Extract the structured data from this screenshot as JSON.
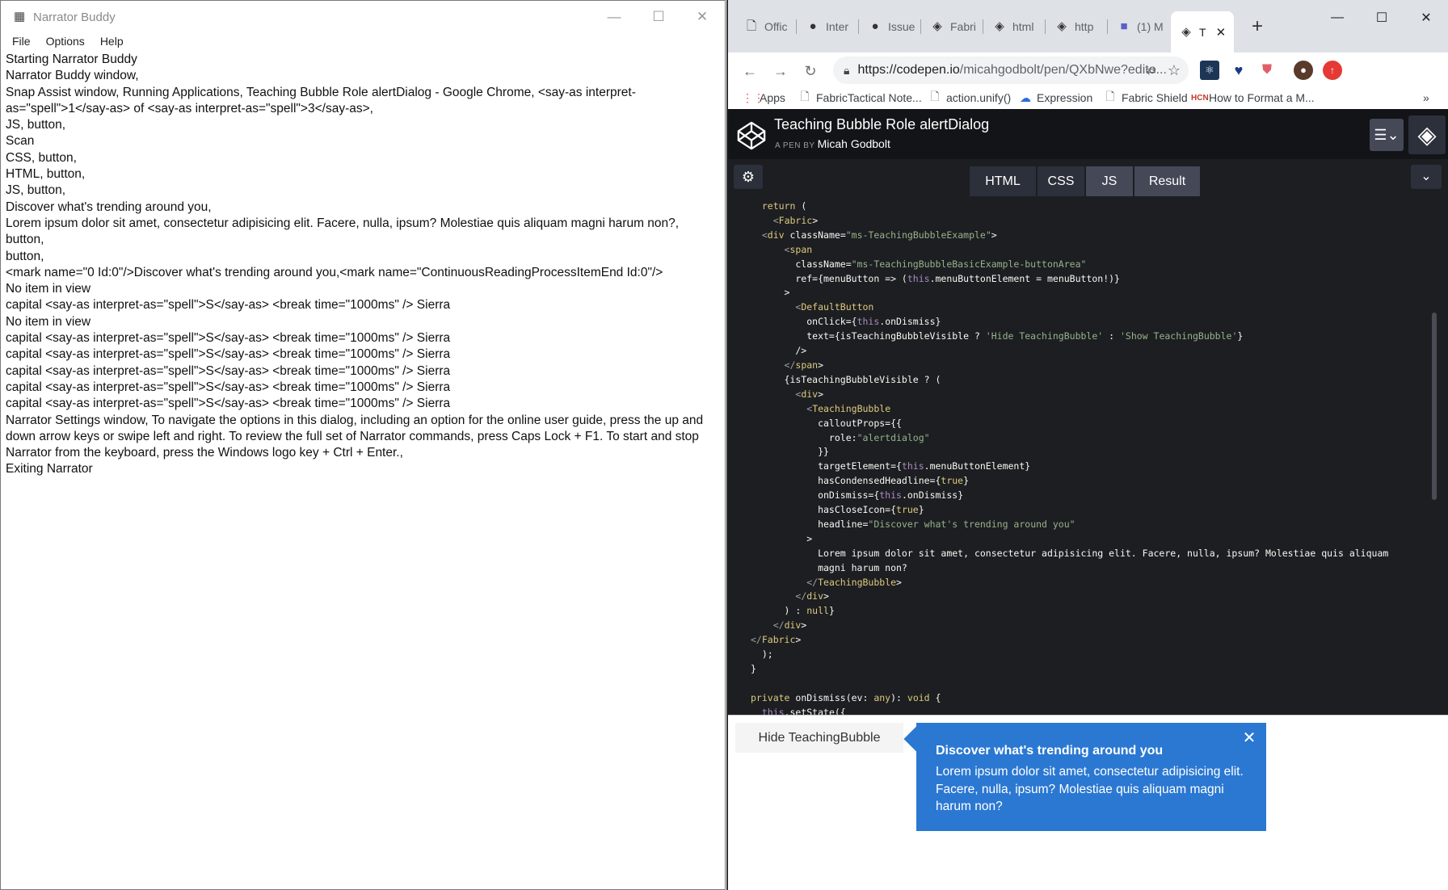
{
  "narrator": {
    "title": "Narrator Buddy",
    "menu": [
      "File",
      "Options",
      "Help"
    ],
    "log": [
      "Starting Narrator Buddy",
      "Narrator Buddy window,",
      "Snap Assist window, Running Applications, Teaching Bubble Role alertDialog - Google Chrome, <say-as interpret-as=\"spell\">1</say-as> of <say-as interpret-as=\"spell\">3</say-as>,",
      "JS, button,",
      "Scan",
      "CSS, button,",
      "HTML, button,",
      "JS, button,",
      "Discover what's trending around you,",
      "Lorem ipsum dolor sit amet, consectetur adipisicing elit. Facere, nulla, ipsum? Molestiae quis aliquam magni harum non?, button,",
      "button,",
      "<mark name=\"0 Id:0\"/>Discover what's trending around you,<mark name=\"ContinuousReadingProcessItemEnd Id:0\"/>",
      "No item in view",
      "capital <say-as interpret-as=\"spell\">S</say-as> <break time=\"1000ms\" /> Sierra",
      "No item in view",
      "capital <say-as interpret-as=\"spell\">S</say-as> <break time=\"1000ms\" /> Sierra",
      "capital <say-as interpret-as=\"spell\">S</say-as> <break time=\"1000ms\" /> Sierra",
      "capital <say-as interpret-as=\"spell\">S</say-as> <break time=\"1000ms\" /> Sierra",
      "capital <say-as interpret-as=\"spell\">S</say-as> <break time=\"1000ms\" /> Sierra",
      "capital <say-as interpret-as=\"spell\">S</say-as> <break time=\"1000ms\" /> Sierra",
      "Narrator Settings window, To navigate the options in this dialog, including an option for the online user guide, press the up and down arrow keys or swipe left and right. To review the full set of Narrator commands, press Caps Lock + F1. To start and stop Narrator from the keyboard, press the Windows logo key + Ctrl + Enter.,",
      "Exiting Narrator"
    ]
  },
  "chrome": {
    "tabs": [
      {
        "label": "Offic",
        "icon": "document-icon"
      },
      {
        "label": "Inter",
        "icon": "github-icon"
      },
      {
        "label": "Issue",
        "icon": "github-icon"
      },
      {
        "label": "Fabri",
        "icon": "codepen-icon"
      },
      {
        "label": "html",
        "icon": "codepen-icon"
      },
      {
        "label": "http",
        "icon": "codepen-icon"
      },
      {
        "label": "(1) M",
        "icon": "teams-icon"
      },
      {
        "label": "T",
        "icon": "codepen-icon"
      }
    ],
    "url_host": "https://codepen.io",
    "url_rest": "/micahgodbolt/pen/QXbNwe?edito...",
    "bookmarks": [
      {
        "label": "Apps",
        "icon": "apps-icon"
      },
      {
        "label": "FabricTactical Note...",
        "icon": "document-icon"
      },
      {
        "label": "action.unify()",
        "icon": "document-icon"
      },
      {
        "label": "Expression",
        "icon": "cloud-icon"
      },
      {
        "label": "Fabric Shield",
        "icon": "document-icon"
      },
      {
        "label": "How to Format a M...",
        "icon": "site-icon"
      }
    ],
    "more_bookmarks": "»"
  },
  "codepen": {
    "title": "Teaching Bubble Role alertDialog",
    "by": "A PEN BY",
    "author": "Micah Godbolt",
    "tabs": [
      "HTML",
      "CSS",
      "JS",
      "Result"
    ],
    "active_tab": "JS"
  },
  "code_lines": [
    "  return (",
    "    <Fabric>",
    "  <div className=\"ms-TeachingBubbleExample\">",
    "      <span",
    "        className=\"ms-TeachingBubbleBasicExample-buttonArea\"",
    "        ref={menuButton => (this.menuButtonElement = menuButton!)}",
    "      >",
    "        <DefaultButton",
    "          onClick={this.onDismiss}",
    "          text={isTeachingBubbleVisible ? 'Hide TeachingBubble' : 'Show TeachingBubble'}",
    "        />",
    "      </span>",
    "      {isTeachingBubbleVisible ? (",
    "        <div>",
    "          <TeachingBubble",
    "            calloutProps={{",
    "              role:\"alertdialog\"",
    "            }}",
    "            targetElement={this.menuButtonElement}",
    "            hasCondensedHeadline={true}",
    "            onDismiss={this.onDismiss}",
    "            hasCloseIcon={true}",
    "            headline=\"Discover what's trending around you\"",
    "          >",
    "            Lorem ipsum dolor sit amet, consectetur adipisicing elit. Facere, nulla, ipsum? Molestiae quis aliquam",
    "            magni harum non?",
    "          </TeachingBubble>",
    "        </div>",
    "      ) : null}",
    "    </div>",
    "</Fabric>",
    "  );",
    "}",
    "",
    "private onDismiss(ev: any): void {",
    "  this.setState({"
  ],
  "result": {
    "button_label": "Hide TeachingBubble",
    "headline": "Discover what's trending around you",
    "body": "Lorem ipsum dolor sit amet, consectetur adipisicing elit. Facere, nulla, ipsum? Molestiae quis aliquam magni harum non?"
  },
  "colors": {
    "bubble": "#2b78d2",
    "codepen_bg": "#1d1e22"
  }
}
